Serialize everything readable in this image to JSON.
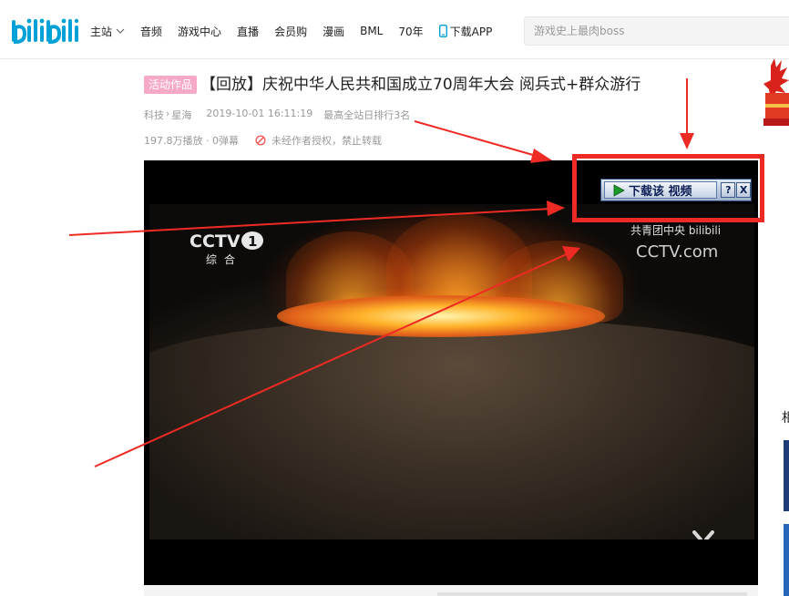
{
  "header": {
    "logo_text": "bilibili",
    "nav": [
      {
        "label": "主站",
        "has_dropdown": true
      },
      {
        "label": "音频"
      },
      {
        "label": "游戏中心"
      },
      {
        "label": "直播"
      },
      {
        "label": "会员购"
      },
      {
        "label": "漫画"
      },
      {
        "label": "BML"
      },
      {
        "label": "70年"
      },
      {
        "label": "下载APP",
        "icon": "phone-icon"
      }
    ],
    "search_placeholder": "游戏史上最肉boss"
  },
  "video": {
    "badge": "活动作品",
    "title": "【回放】庆祝中华人民共和国成立70周年大会 阅兵式+群众游行",
    "category": "科技",
    "subcategory": "星海",
    "datetime": "2019-10-01 16:11:19",
    "rank": "最高全站日排行3名",
    "plays": "197.8万播放",
    "danmaku": "0弹幕",
    "copyright_notice": "未经作者授权，禁止转载"
  },
  "player": {
    "watermark_left_logo": "CCTV",
    "watermark_left_channel": "1",
    "watermark_left_cn": "综合",
    "watermark_right_top": "共青团中央 bilibili",
    "watermark_right_bottom": "CCTV.com"
  },
  "download_toolbar": {
    "download_label": "下载该 视频",
    "help_label": "?",
    "close_label": "X"
  },
  "sidebar": {
    "partial_char": "相"
  },
  "colors": {
    "brand": "#00a1d6",
    "badge": "#f6a9c6",
    "annotation": "#ee2a24",
    "toolbar_text": "#0b1e55"
  }
}
